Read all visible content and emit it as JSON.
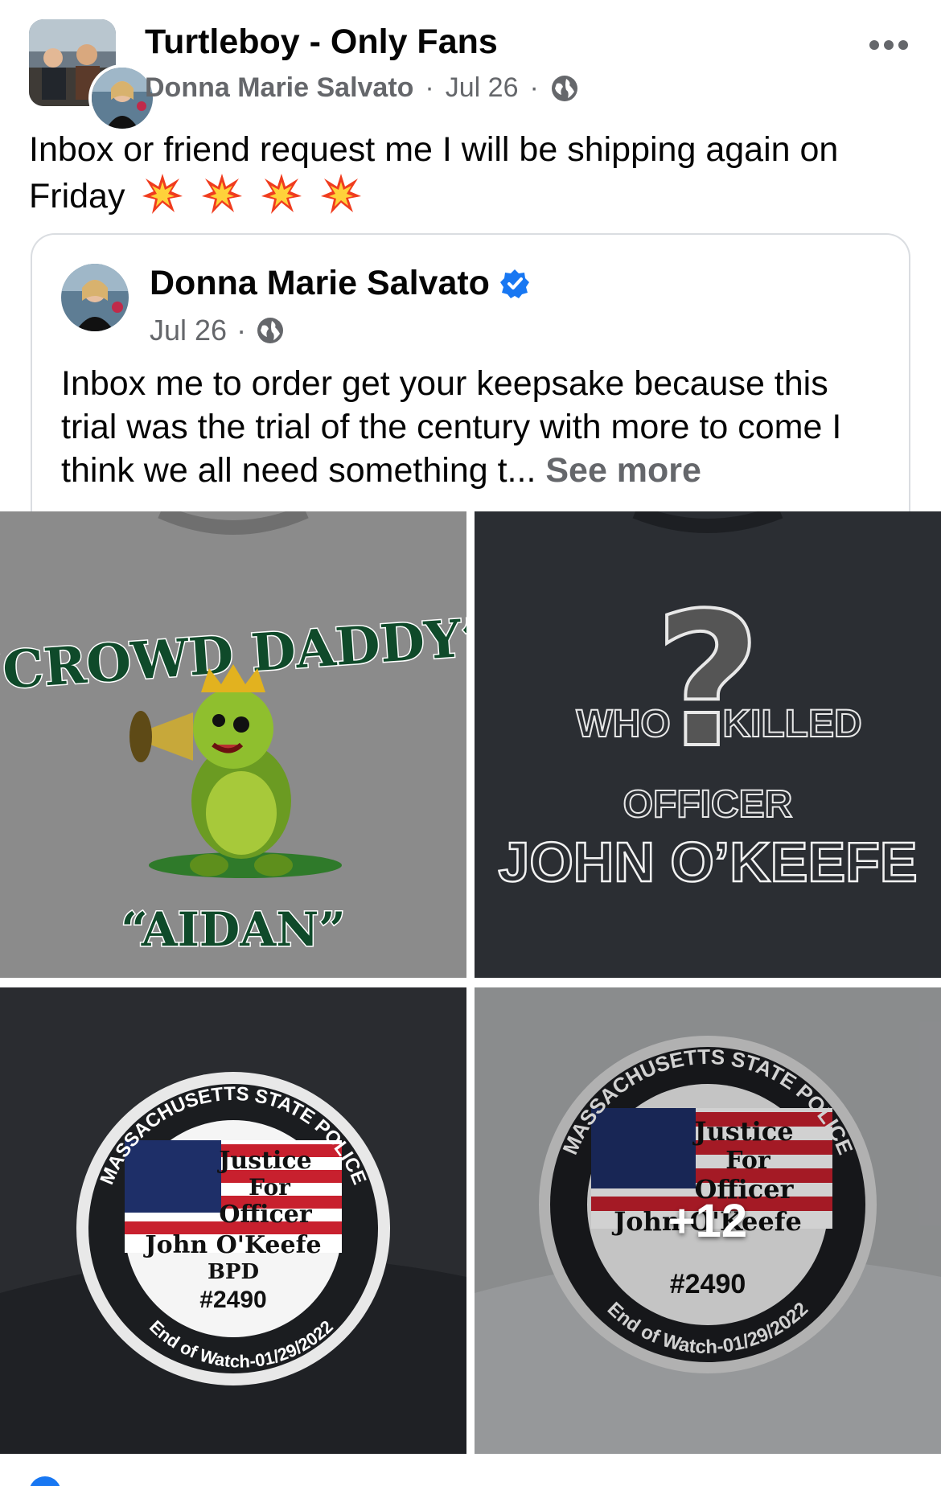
{
  "header": {
    "group_name": "Turtleboy - Only Fans",
    "author": "Donna Marie Salvato",
    "separator": "·",
    "date": "Jul 26",
    "privacy_icon": "globe-icon",
    "more_icon": "more-options-icon"
  },
  "post": {
    "text": "Inbox or friend request me I will be shipping again on Friday",
    "emoji": [
      "collision-emoji",
      "collision-emoji",
      "collision-emoji",
      "collision-emoji"
    ]
  },
  "shared_post": {
    "author": "Donna Marie Salvato",
    "verified": true,
    "date": "Jul 26",
    "separator": "·",
    "text": "Inbox me to order get your keepsake because this trial was the trial of the century with more to come I think we all need something t...",
    "see_more": "See more"
  },
  "photos": [
    {
      "caption_top": "“CROWD DADDY”",
      "caption_bottom": "“AIDAN”",
      "shirt_color": "#8b8b8b"
    },
    {
      "line1_left": "WHO",
      "line1_right": "KILLED",
      "line2": "OFFICER",
      "line3": "JOHN O’KEEFE",
      "shirt_color": "#2b2e33"
    },
    {
      "ring_top": "MASSACHUSETTS STATE POLICE",
      "ring_bottom": "End of Watch-01/29/2022",
      "line1": "Justice",
      "line2": "For",
      "line3": "Officer",
      "line4": "John O'Keefe",
      "line5": "BPD",
      "badge": "#2490",
      "hat_color": "#2a2c30"
    },
    {
      "ring_top": "MASSACHUSETTS STATE POLICE",
      "ring_bottom": "End of Watch-01/29/2022",
      "line1": "Justice",
      "line2": "For",
      "line3": "Officer",
      "line4": "John O'Keefe",
      "badge": "#2490",
      "hat_color": "#a9abad",
      "more_count": "+12"
    }
  ],
  "colors": {
    "primary_text": "#050505",
    "secondary_text": "#65676b",
    "verified_blue": "#1877f2",
    "card_border": "#dadde1"
  }
}
